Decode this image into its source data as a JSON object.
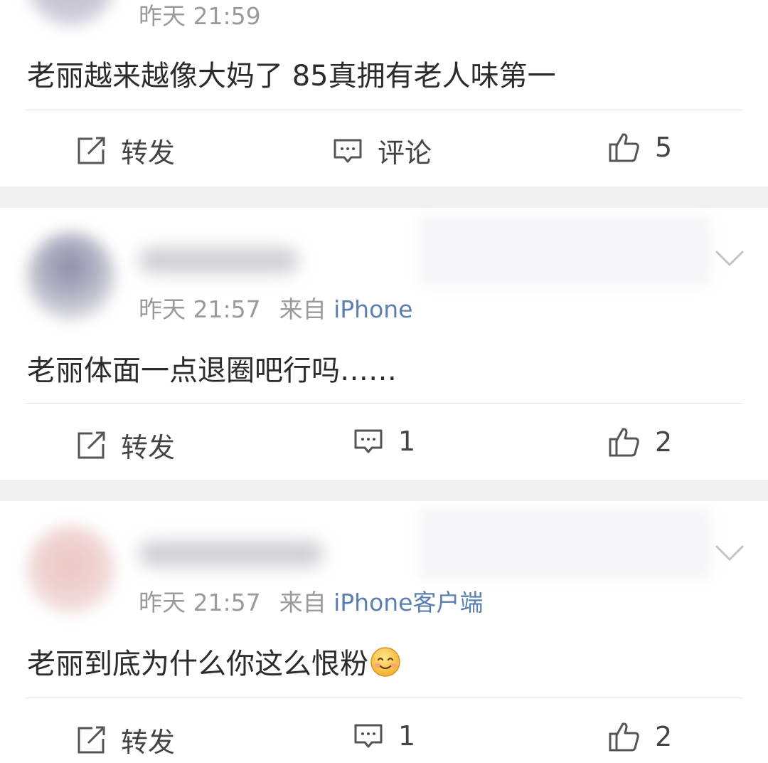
{
  "posts": [
    {
      "time": "昨天 21:59",
      "source_prefix": "",
      "source_device": "",
      "content": "老丽越来越像大妈了 85真拥有老人味第一",
      "repost_label": "转发",
      "comment_label": "评论",
      "like_count": "5"
    },
    {
      "time": "昨天 21:57",
      "source_prefix": "来自",
      "source_device": "iPhone",
      "content": "老丽体面一点退圈吧行吗……",
      "repost_label": "转发",
      "comment_label": "1",
      "like_count": "2"
    },
    {
      "time": "昨天 21:57",
      "source_prefix": "来自",
      "source_device": "iPhone客户端",
      "content": "老丽到底为什么你这么恨粉",
      "emoji": "smile-emoji",
      "repost_label": "转发",
      "comment_label": "1",
      "like_count": "2"
    }
  ],
  "colors": {
    "text": "#2b2b2b",
    "meta": "#9a9a9a",
    "link": "#5b7fae",
    "separator": "#f1f1f1",
    "icon": "#555555"
  },
  "icons": {
    "repost": "repost-icon",
    "comment": "comment-icon",
    "like": "thumbs-up-icon",
    "more": "chevron-down-icon"
  }
}
